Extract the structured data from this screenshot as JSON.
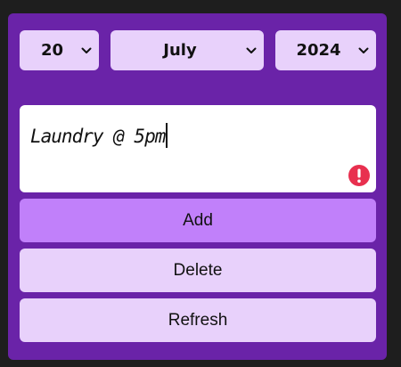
{
  "date_picker": {
    "day": "20",
    "month": "July",
    "year": "2024"
  },
  "note": {
    "value": "Laundry @ 5pm"
  },
  "buttons": {
    "add": "Add",
    "delete": "Delete",
    "refresh": "Refresh"
  },
  "colors": {
    "panel": "#6a23a8",
    "light_control": "#e8d1fb",
    "accent_button": "#c180fa",
    "error": "#e8304f"
  },
  "icons": {
    "select_chevron": "chevron-down-icon",
    "validation": "error-icon"
  }
}
